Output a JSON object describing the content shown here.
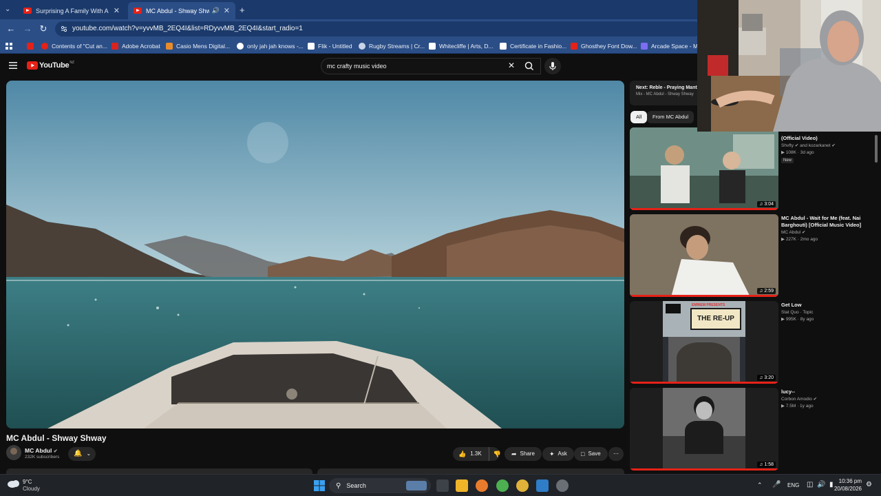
{
  "tabs": [
    {
      "title": "Surprising A Family With A Car"
    },
    {
      "title": "MC Abdul - Shway Shway"
    }
  ],
  "browser": {
    "url": "youtube.com/watch?v=yvvMB_2EQ4I&list=RDyvvMB_2EQ4I&start_radio=1"
  },
  "bookmarks": [
    {
      "label": "Contents of \"Cut an..."
    },
    {
      "label": "Adobe Acrobat"
    },
    {
      "label": "Casio Mens Digital..."
    },
    {
      "label": "only jah jah knows -..."
    },
    {
      "label": "Flik - Untitled"
    },
    {
      "label": "Rugby Streams | Cr..."
    },
    {
      "label": "Whitecliffe | Arts, D..."
    },
    {
      "label": "Certificate in Fashio..."
    },
    {
      "label": "Ghosthey Font Dow..."
    },
    {
      "label": "Arcade Space - Ma"
    }
  ],
  "youtube": {
    "logo": "YouTube",
    "region": "NZ",
    "search_value": "mc crafty music video"
  },
  "video": {
    "title": "MC Abdul - Shway Shway",
    "channel": "MC Abdul",
    "subscribers": "232K subscribers",
    "likes": "1.3K",
    "share": "Share",
    "ask": "Ask",
    "save": "Save"
  },
  "up_next": {
    "title": "Next: Reble - Praying Manti",
    "subtitle": "Mix - MC Abdul - Shway Shway"
  },
  "chips": [
    {
      "label": "All"
    },
    {
      "label": "From MC Abdul"
    }
  ],
  "recommendations": [
    {
      "title": "(Official Video)",
      "channel": "Shvfty",
      "channel_extra": "and kozarkanet",
      "meta": "108K · 3d ago",
      "badge": "New",
      "duration": "3:04"
    },
    {
      "title": "MC Abdul - Wait for Me (feat. Nai Barghouti) [Official Music Video]",
      "channel": "MC Abdul",
      "meta": "227K · 2mo ago",
      "duration": "2:59"
    },
    {
      "title": "Get Low",
      "channel": "Stat Quo · Topic",
      "meta": "995K · 8y ago",
      "duration": "3:20",
      "art_title": "THE RE-UP",
      "art_top": "EMINEM PRESENTS"
    },
    {
      "title": "lucy--",
      "channel": "Corbon Amodio",
      "meta": "7.5M · 1y ago",
      "duration": "1:58"
    }
  ],
  "taskbar": {
    "temperature": "9°C",
    "weather": "Cloudy",
    "search": "Search",
    "language": "ENG",
    "time": "10:36 pm",
    "date": "20/08/2026"
  },
  "colors": {
    "youtube_red": "#e62117",
    "chrome_frame": "#1b3a6b",
    "chrome_toolbar": "#2b4e87",
    "yt_background": "#0f0f0f"
  }
}
